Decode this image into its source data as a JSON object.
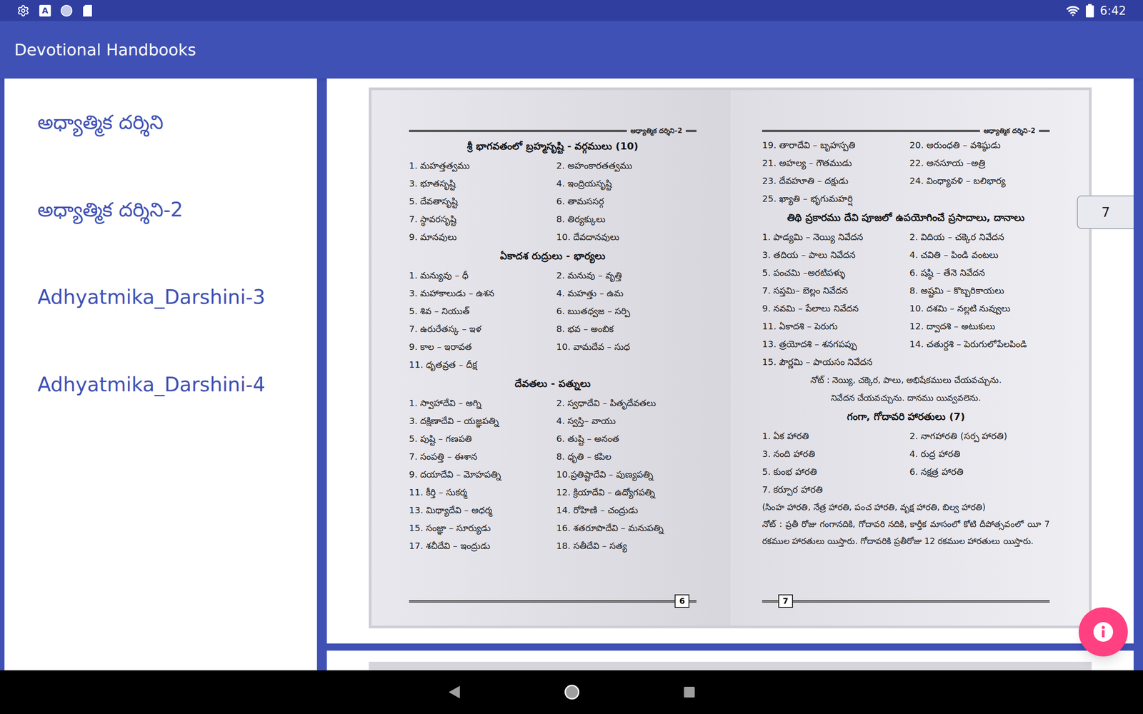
{
  "status_bar": {
    "keyboard_icon_letter": "A",
    "time": "6:42"
  },
  "app_bar": {
    "title": "Devotional Handbooks"
  },
  "sidebar": {
    "items": [
      {
        "label": "అధ్యాత్మిక దర్శిని"
      },
      {
        "label": "అధ్యాత్మిక దర్శిని-2"
      },
      {
        "label": "Adhyatmika_Darshini-3"
      },
      {
        "label": "Adhyatmika_Darshini-4"
      }
    ]
  },
  "page_badge": "7",
  "document": {
    "pages": [
      {
        "header": "ఆధ్యాత్మిక దర్శిని-2",
        "number": "6",
        "blocks": [
          {
            "kind": "title",
            "text": "శ్రీ భాగవతంలో బ్రహ్మసృష్టి - వర్గములు (10)"
          },
          {
            "kind": "list",
            "items": [
              "1. మహత్తత్వము",
              "2. అహంకారతత్వము",
              "3. భూతసృష్టి",
              "4. ఇంద్రియసృష్టి",
              "5. దేవతాసృష్టి",
              "6. తామససర్గ",
              "7. స్థావరసృష్టి",
              "8. తిర్యక్కులు",
              "9. మానవులు",
              "10. దేవదానవులు"
            ]
          },
          {
            "kind": "title",
            "text": "ఏకాదశ రుద్రులు - భార్యలు"
          },
          {
            "kind": "list",
            "items": [
              "1. మన్యువు – ధీ",
              "2. మనువు – వృత్తి",
              "3. మహాకాలుడు – ఉశన",
              "4. మహత్తు – ఉమ",
              "5. శివ – నియుత్",
              "6. ఋతధ్వజ – సర్పి",
              "7. ఉరురేతస్క – ఇళ",
              "8. భవ – అంబిక",
              "9. కాల – ఇరావత",
              "10. వామదేవ – సుధ",
              "11. ధృతవ్రత – దీక్ష"
            ]
          },
          {
            "kind": "title",
            "text": "దేవతలు - పత్నులు"
          },
          {
            "kind": "list",
            "items": [
              "1. స్వాహాదేవి – అగ్ని",
              "2. స్వధాదేవి – పితృదేవతలు",
              "3. దక్షిణాదేవి – యజ్ఞపత్ని",
              "4. స్వస్తి– వాయు",
              "5. పుష్టి – గణపతి",
              "6. తుష్టి – అనంత",
              "7. సంపత్తి – ఈశాన",
              "8. ధృతి – కపిల",
              "9. దయాదేవి – మోహపత్ని",
              "10.ప్రతిష్టాదేవి – పుణ్యపత్ని",
              "11. కీర్తి – సుకర్మ",
              "12. క్రియాదేవి – ఉద్యోగపత్ని",
              "13. మిథ్యాదేవి – అధర్మ",
              "14. రోహిణి – చంద్రుడు",
              "15. సంజ్ఞా – సూర్యుడు",
              "16. శతరూపాదేవి – మనుపత్ని",
              "17. శచీదేవి – ఇంద్రుడు",
              "18. సతీదేవి – సత్య"
            ]
          }
        ]
      },
      {
        "header": "ఆధ్యాత్మిక దర్శిని-2",
        "number": "7",
        "blocks": [
          {
            "kind": "list",
            "items": [
              "19. తారాదేవి – బృహస్పతి",
              "20. అరుంధతి – వశిష్ఠుడు",
              "21. అహల్య – గౌతముడు",
              "22. అనసూయ –అత్రి",
              "23. దేవహూతి – దక్షుడు",
              "24. వింధ్యావళి – బలిభార్య",
              "25. ఖ్యాతి – భృగుమహర్షి"
            ]
          },
          {
            "kind": "title",
            "text": "తిథి ప్రకారము దేవి పూజలో ఉపయోగించే ప్రసాదాలు, దానాలు"
          },
          {
            "kind": "list",
            "items": [
              "1. పాడ్యమి – నెయ్యి నివేదన",
              "2. విదియ – చక్కెర నివేదన",
              "3. తదియ – పాలు నివేదన",
              "4. చవితి – పిండి వంటలు",
              "5. పంచమి –అరటిపళ్ళు",
              "6. షష్ఠి – తేనె నివేదన",
              "7. సప్తమి– బెల్లం నివేదన",
              "8. అష్టమి – కొబ్బరికాయలు",
              "9. నవమి – పేలాలు నివేదన",
              "10. దశమి – నల్లటి నువ్వులు",
              "11. ఏకాదశి – పెరుగు",
              "12. ద్వాదశి – అటుకులు",
              "13. త్రయోదశి – శనగపప్పు",
              "14. చతుర్దశి – పెరుగులోపేలపిండి",
              "15. పౌర్ణమి – పాయసం నివేదన"
            ]
          },
          {
            "kind": "note",
            "lines": [
              "నోట్ : నెయ్యి, చక్కెర, పాలు, అభిషేకములు చేయవచ్చును.",
              "నివేదన చేయవచ్చును. దానము యివ్వవలెను."
            ]
          },
          {
            "kind": "title",
            "text": "గంగా, గోదావరి హారతులు (7)"
          },
          {
            "kind": "list",
            "items": [
              "1. ఏక హారతి",
              "2. నాగహారతి (సర్ప హారతి)",
              "3. నంది హారతి",
              "4. రుద్ర హారతి",
              "5. కుంభ హారతి",
              "6. నక్షత్ర హారతి",
              "7. కర్పూర హారతి"
            ]
          },
          {
            "kind": "paragraph",
            "text": "(సింహ హారతి, నేత్ర హారతి, పంచ హారతి, వృక్ష హారతి, బిల్వ హారతి)"
          },
          {
            "kind": "paragraph",
            "text": "నోట్ : ప్రతీ రోజు గంగానదికి, గోదావరి నదికి, కార్తీక మాసంలో కోటి దీపోత్సవంలో యీ 7 రకముల హారతులు యిస్తారు. గోదావరికి ప్రతీరోజు 12 రకముల హారతులు యిస్తారు."
          }
        ]
      }
    ]
  }
}
